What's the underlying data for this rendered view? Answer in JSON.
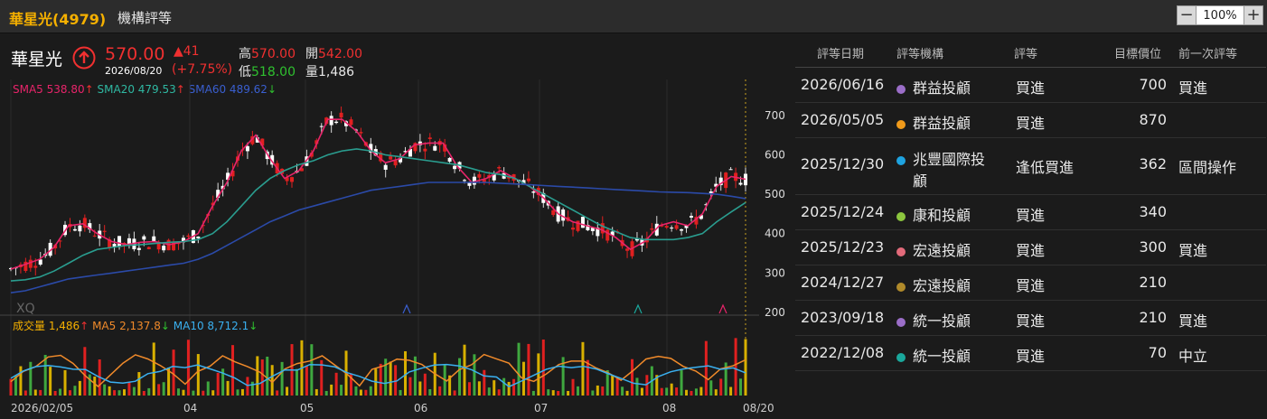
{
  "header": {
    "stock_title": "華星光(4979)",
    "section_title": "機構評等"
  },
  "zoom": {
    "minus": "−",
    "value": "100%",
    "plus": "+"
  },
  "quote": {
    "name": "華星光",
    "price": "570.00",
    "date": "2026/08/20",
    "change": "▲41",
    "change_pct": "(+7.75%)",
    "high_label": "高",
    "high": "570.00",
    "open_label": "開",
    "open": "542.00",
    "low_label": "低",
    "low": "518.00",
    "vol_label": "量",
    "vol": "1,486"
  },
  "sma": {
    "sma5": "SMA5 538.80",
    "sma20": "SMA20 479.53",
    "sma60": "SMA60 489.62"
  },
  "volume_legend": {
    "vol": "成交量 1,486",
    "ma5": "MA5 2,137.8",
    "ma10": "MA10 8,712.1"
  },
  "watermark": "XQ",
  "chart_data": {
    "type": "candlestick",
    "y_ticks": [
      "700",
      "600",
      "500",
      "400",
      "300",
      "200"
    ],
    "x_ticks": [
      "2026/02/05",
      "04",
      "05",
      "06",
      "07",
      "08",
      "08/20"
    ],
    "ylim": [
      200,
      750
    ],
    "series": [
      {
        "name": "SMA5",
        "color": "#e8246a",
        "values": [
          310,
          322,
          335,
          365,
          420,
          425,
          400,
          380,
          372,
          378,
          380,
          372,
          380,
          400,
          470,
          530,
          610,
          650,
          590,
          540,
          560,
          610,
          690,
          690,
          660,
          610,
          580,
          590,
          625,
          630,
          630,
          570,
          530,
          540,
          560,
          540,
          520,
          490,
          450,
          430,
          420,
          410,
          390,
          360,
          380,
          420,
          430,
          420,
          450,
          520,
          545,
          538
        ]
      },
      {
        "name": "SMA20",
        "color": "#2a9d8f",
        "values": [
          280,
          283,
          290,
          305,
          325,
          345,
          360,
          365,
          370,
          372,
          375,
          378,
          380,
          385,
          400,
          430,
          470,
          510,
          540,
          560,
          575,
          585,
          600,
          610,
          615,
          610,
          600,
          595,
          590,
          585,
          580,
          575,
          565,
          555,
          550,
          540,
          520,
          500,
          480,
          460,
          440,
          420,
          405,
          390,
          385,
          385,
          385,
          390,
          400,
          430,
          455,
          479
        ]
      },
      {
        "name": "SMA60",
        "color": "#2b4aa8",
        "values": [
          250,
          255,
          265,
          275,
          285,
          290,
          295,
          300,
          305,
          310,
          315,
          320,
          325,
          335,
          350,
          370,
          390,
          410,
          430,
          445,
          460,
          470,
          480,
          490,
          500,
          510,
          515,
          520,
          525,
          530,
          530,
          530,
          530,
          530,
          528,
          526,
          524,
          522,
          520,
          518,
          516,
          514,
          512,
          510,
          508,
          506,
          505,
          504,
          502,
          500,
          495,
          489
        ]
      }
    ]
  },
  "ratings": {
    "headers": [
      "評等日期",
      "評等機構",
      "評等",
      "目標價位",
      "前一次評等"
    ],
    "rows": [
      {
        "date": "2026/06/16",
        "dot": "#9b6ec8",
        "broker": "群益投顧",
        "rating": "買進",
        "target": "700",
        "prev": "買進"
      },
      {
        "date": "2026/05/05",
        "dot": "#f09a1a",
        "broker": "群益投顧",
        "rating": "買進",
        "target": "870",
        "prev": ""
      },
      {
        "date": "2025/12/30",
        "dot": "#1ea3e0",
        "broker": "兆豐國際投",
        "broker2": "顧",
        "rating": "逢低買進",
        "target": "362",
        "prev": "區間操作"
      },
      {
        "date": "2025/12/24",
        "dot": "#8cc63e",
        "broker": "康和投顧",
        "rating": "買進",
        "target": "340",
        "prev": ""
      },
      {
        "date": "2025/12/23",
        "dot": "#e26a7a",
        "broker": "宏遠投顧",
        "rating": "買進",
        "target": "300",
        "prev": "買進"
      },
      {
        "date": "2024/12/27",
        "dot": "#b08a2a",
        "broker": "宏遠投顧",
        "rating": "買進",
        "target": "210",
        "prev": ""
      },
      {
        "date": "2023/09/18",
        "dot": "#9b6ec8",
        "broker": "統一投顧",
        "rating": "買進",
        "target": "210",
        "prev": "買進"
      },
      {
        "date": "2022/12/08",
        "dot": "#1aa89c",
        "broker": "統一投顧",
        "rating": "買進",
        "target": "70",
        "prev": "中立"
      }
    ]
  }
}
